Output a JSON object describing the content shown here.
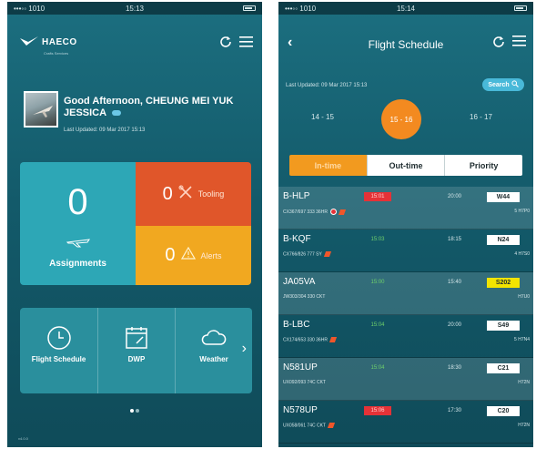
{
  "left": {
    "status": {
      "carrier": "•••◦◦ 1010",
      "time": "15:13"
    },
    "logo": {
      "name": "HAECO",
      "tagline": "Crafts Services"
    },
    "greeting": {
      "text": "Good Afternoon, CHEUNG MEI YUK JESSICA",
      "updated": "Last Updated: 09 Mar 2017 15:13"
    },
    "assignments": {
      "count": "0",
      "label": "Assignments"
    },
    "tooling": {
      "count": "0",
      "label": "Tooling"
    },
    "alerts": {
      "count": "0",
      "label": "Alerts"
    },
    "shortcuts": [
      {
        "label": "Flight Schedule",
        "icon": "clock-icon"
      },
      {
        "label": "DWP",
        "icon": "calendar-icon"
      },
      {
        "label": "Weather",
        "icon": "cloud-icon"
      }
    ],
    "version": "v4.0.0"
  },
  "right": {
    "status": {
      "carrier": "•••◦◦ 1010",
      "time": "15:14"
    },
    "title": "Flight Schedule",
    "last_updated": "Last Updated: 09 Mar 2017 15:13",
    "search_label": "Search",
    "dates": [
      "14 - 15",
      "15 - 16",
      "16 - 17"
    ],
    "tabs": [
      "In-time",
      "Out-time",
      "Priority"
    ],
    "flights": [
      {
        "reg": "B-HLP",
        "time": "15:01",
        "time_style": "red",
        "sched": "20:00",
        "bay": "W44",
        "bay_style": "white",
        "detail": "CX367/697  333  36HR",
        "icons": [
          "wheel",
          "tool"
        ],
        "right": "5  H7P0"
      },
      {
        "reg": "B-KQF",
        "time": "15:03",
        "time_style": "green",
        "sched": "18:15",
        "bay": "N24",
        "bay_style": "white",
        "detail": "CX766/826  777  SY",
        "icons": [
          "tool"
        ],
        "right": "4  H7S0"
      },
      {
        "reg": "JA05VA",
        "time": "15:00",
        "time_style": "green",
        "sched": "15:40",
        "bay": "S202",
        "bay_style": "yellow",
        "detail": "JW303/304  330  CKT",
        "icons": [],
        "right": "H7U0"
      },
      {
        "reg": "B-LBC",
        "time": "15:04",
        "time_style": "green",
        "sched": "20:00",
        "bay": "S49",
        "bay_style": "white",
        "detail": "CX174/653  330  36HR",
        "icons": [
          "tool"
        ],
        "right": "5  H7N4"
      },
      {
        "reg": "N581UP",
        "time": "15:04",
        "time_style": "green",
        "sched": "18:30",
        "bay": "C21",
        "bay_style": "white",
        "detail": "UX092/093  74C  CKT",
        "icons": [],
        "right": "H72N"
      },
      {
        "reg": "N578UP",
        "time": "15:06",
        "time_style": "red",
        "sched": "17:30",
        "bay": "C20",
        "bay_style": "white",
        "detail": "UX058/061  74C  CKT",
        "icons": [
          "tool"
        ],
        "right": "H72N"
      }
    ]
  },
  "colors": {
    "bg": "#135a6a",
    "assign": "#2da7b6",
    "tooling": "#e0562a",
    "alerts": "#f1a820",
    "accent": "#f38a20"
  }
}
